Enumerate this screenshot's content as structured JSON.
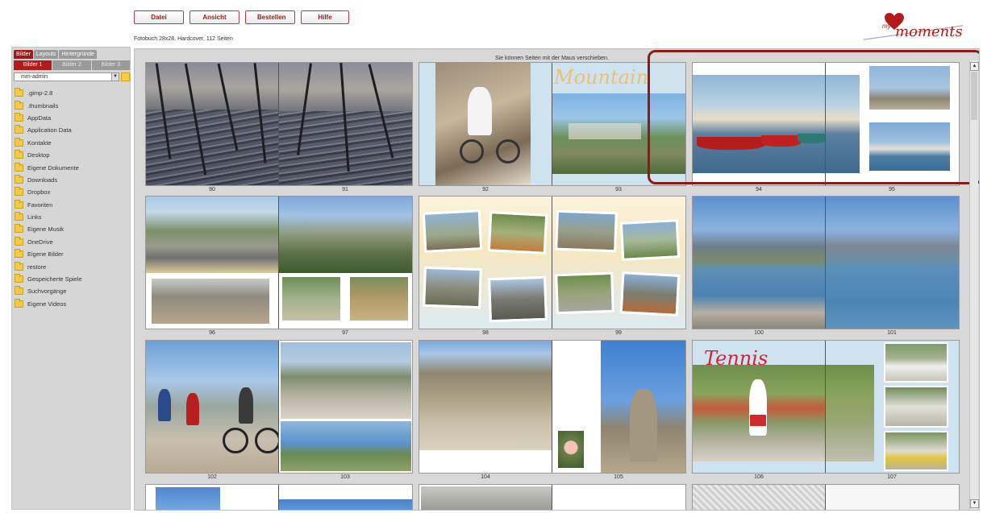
{
  "menu": {
    "file": "Datei",
    "view": "Ansicht",
    "order": "Bestellen",
    "help": "Hilfe"
  },
  "book_info": "Fotobuch 28x28, Hardcover, 112 Seiten",
  "logo": {
    "prefix": "my",
    "name": "moments"
  },
  "sidebar": {
    "top_tabs": [
      "Bilder",
      "Layouts",
      "Hintergründe"
    ],
    "sub_tabs": [
      "Bilder 1",
      "Bilder 2",
      "Bilder 3"
    ],
    "directory": "mm-admin",
    "folders": [
      ".gimp-2.8",
      ".thumbnails",
      "AppData",
      "Application Data",
      "Kontakte",
      "Desktop",
      "Eigene Dokumente",
      "Downloads",
      "Dropbox",
      "Favoriten",
      "Links",
      "Eigene Musik",
      "OneDrive",
      "Eigene Bilder",
      "restore",
      "Gespeicherte Spiele",
      "Suchvorgänge",
      "Eigene Videos"
    ]
  },
  "main": {
    "hint": "Sie können Seiten mit der Maus verschieben.",
    "page_labels": [
      "90",
      "91",
      "92",
      "93",
      "94",
      "95",
      "96",
      "97",
      "98",
      "99",
      "100",
      "101",
      "102",
      "103",
      "104",
      "105",
      "106",
      "107"
    ],
    "titles": {
      "mountain": "Mountain",
      "tennis": "Tennis"
    }
  },
  "colors": {
    "accent": "#9b1b1b",
    "highlight": "#8b1a1a"
  }
}
